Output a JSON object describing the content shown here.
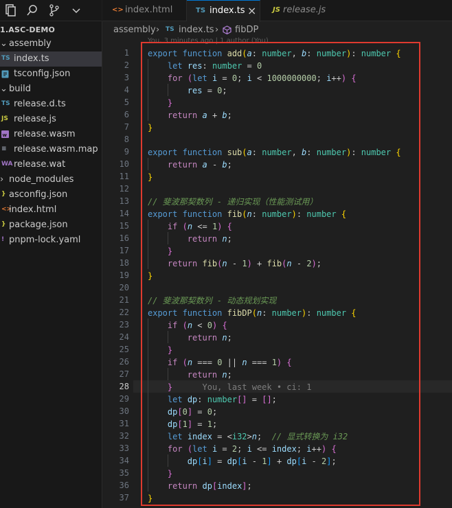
{
  "explorer": {
    "root": "1.ASC-DEMO",
    "items": [
      {
        "label": "assembly",
        "type": "folder",
        "open": true,
        "depth": 0
      },
      {
        "label": "index.ts",
        "type": "ts",
        "badge": "TS",
        "depth": 1,
        "active": true
      },
      {
        "label": "tsconfig.json",
        "type": "json",
        "badge": "",
        "depth": 1
      },
      {
        "label": "build",
        "type": "folder",
        "open": true,
        "depth": 0
      },
      {
        "label": "release.d.ts",
        "type": "ts",
        "badge": "TS",
        "depth": 1
      },
      {
        "label": "release.js",
        "type": "js",
        "badge": "JS",
        "depth": 1
      },
      {
        "label": "release.wasm",
        "type": "wasm",
        "badge": "",
        "depth": 1
      },
      {
        "label": "release.wasm.map",
        "type": "map",
        "badge": "≡",
        "depth": 1
      },
      {
        "label": "release.wat",
        "type": "wat",
        "badge": "WA",
        "depth": 1
      },
      {
        "label": "node_modules",
        "type": "folder",
        "open": false,
        "depth": 0
      },
      {
        "label": "asconfig.json",
        "type": "json",
        "badge": "}",
        "depth": 0
      },
      {
        "label": "index.html",
        "type": "html",
        "badge": "<>",
        "depth": 0
      },
      {
        "label": "package.json",
        "type": "json",
        "badge": "}",
        "depth": 0
      },
      {
        "label": "pnpm-lock.yaml",
        "type": "yaml",
        "badge": "!",
        "depth": 0
      }
    ]
  },
  "tabs": [
    {
      "label": "index.html",
      "icon": "<>",
      "active": false
    },
    {
      "label": "index.ts",
      "icon": "TS",
      "active": true,
      "close": "×"
    },
    {
      "label": "release.js",
      "icon": "JS",
      "active": false
    }
  ],
  "breadcrumb": {
    "folder": "assembly",
    "file_badge": "TS",
    "file": "index.ts",
    "symbol": "fibDP"
  },
  "codelens": "You, 3 minutes ago | 1 author (You)",
  "editor": {
    "current_line": 28,
    "line_numbers": [
      "1",
      "2",
      "3",
      "4",
      "5",
      "6",
      "7",
      "8",
      "9",
      "10",
      "11",
      "12",
      "13",
      "14",
      "15",
      "16",
      "17",
      "18",
      "19",
      "20",
      "21",
      "22",
      "23",
      "24",
      "25",
      "26",
      "27",
      "28",
      "29",
      "30",
      "31",
      "32",
      "33",
      "34",
      "35",
      "36",
      "37"
    ],
    "lines": [
      [
        [
          "kw",
          "export "
        ],
        [
          "kw",
          "function "
        ],
        [
          "fn",
          "add"
        ],
        [
          "b1",
          "("
        ],
        [
          "pm",
          "a"
        ],
        [
          "p",
          ": "
        ],
        [
          "ty",
          "number"
        ],
        [
          "p",
          ", "
        ],
        [
          "pm",
          "b"
        ],
        [
          "p",
          ": "
        ],
        [
          "ty",
          "number"
        ],
        [
          "b1",
          ")"
        ],
        [
          "p",
          ": "
        ],
        [
          "ty",
          "number"
        ],
        [
          "p",
          " "
        ],
        [
          "b1",
          "{"
        ]
      ],
      [
        [
          "p",
          "    "
        ],
        [
          "kw",
          "let "
        ],
        [
          "vr",
          "res"
        ],
        [
          "p",
          ": "
        ],
        [
          "ty",
          "number"
        ],
        [
          "p",
          " = "
        ],
        [
          "nm",
          "0"
        ]
      ],
      [
        [
          "p",
          "    "
        ],
        [
          "kc",
          "for "
        ],
        [
          "b2",
          "("
        ],
        [
          "kw",
          "let "
        ],
        [
          "vr",
          "i"
        ],
        [
          "p",
          " = "
        ],
        [
          "nm",
          "0"
        ],
        [
          "p",
          "; "
        ],
        [
          "vr",
          "i"
        ],
        [
          "p",
          " < "
        ],
        [
          "nm",
          "1000000000"
        ],
        [
          "p",
          "; "
        ],
        [
          "vr",
          "i"
        ],
        [
          "p",
          "++"
        ],
        [
          "b2",
          ")"
        ],
        [
          "p",
          " "
        ],
        [
          "b2",
          "{"
        ]
      ],
      [
        [
          "p",
          "        "
        ],
        [
          "vr",
          "res"
        ],
        [
          "p",
          " = "
        ],
        [
          "nm",
          "0"
        ],
        [
          "p",
          ";"
        ]
      ],
      [
        [
          "p",
          "    "
        ],
        [
          "b2",
          "}"
        ]
      ],
      [
        [
          "p",
          "    "
        ],
        [
          "kc",
          "return "
        ],
        [
          "pm",
          "a"
        ],
        [
          "p",
          " + "
        ],
        [
          "pm",
          "b"
        ],
        [
          "p",
          ";"
        ]
      ],
      [
        [
          "b1",
          "}"
        ]
      ],
      [],
      [
        [
          "kw",
          "export "
        ],
        [
          "kw",
          "function "
        ],
        [
          "fn",
          "sub"
        ],
        [
          "b1",
          "("
        ],
        [
          "pm",
          "a"
        ],
        [
          "p",
          ": "
        ],
        [
          "ty",
          "number"
        ],
        [
          "p",
          ", "
        ],
        [
          "pm",
          "b"
        ],
        [
          "p",
          ": "
        ],
        [
          "ty",
          "number"
        ],
        [
          "b1",
          ")"
        ],
        [
          "p",
          ": "
        ],
        [
          "ty",
          "number"
        ],
        [
          "p",
          " "
        ],
        [
          "b1",
          "{"
        ]
      ],
      [
        [
          "p",
          "    "
        ],
        [
          "kc",
          "return "
        ],
        [
          "pm",
          "a"
        ],
        [
          "p",
          " - "
        ],
        [
          "pm",
          "b"
        ],
        [
          "p",
          ";"
        ]
      ],
      [
        [
          "b1",
          "}"
        ]
      ],
      [],
      [
        [
          "cm",
          "// 斐波那契数列 - 递归实现（性能测试用）"
        ]
      ],
      [
        [
          "kw",
          "export "
        ],
        [
          "kw",
          "function "
        ],
        [
          "fn",
          "fib"
        ],
        [
          "b1",
          "("
        ],
        [
          "pm",
          "n"
        ],
        [
          "p",
          ": "
        ],
        [
          "ty",
          "number"
        ],
        [
          "b1",
          ")"
        ],
        [
          "p",
          ": "
        ],
        [
          "ty",
          "number"
        ],
        [
          "p",
          " "
        ],
        [
          "b1",
          "{"
        ]
      ],
      [
        [
          "p",
          "    "
        ],
        [
          "kc",
          "if "
        ],
        [
          "b2",
          "("
        ],
        [
          "pm",
          "n"
        ],
        [
          "p",
          " <= "
        ],
        [
          "nm",
          "1"
        ],
        [
          "b2",
          ")"
        ],
        [
          "p",
          " "
        ],
        [
          "b2",
          "{"
        ]
      ],
      [
        [
          "p",
          "        "
        ],
        [
          "kc",
          "return "
        ],
        [
          "pm",
          "n"
        ],
        [
          "p",
          ";"
        ]
      ],
      [
        [
          "p",
          "    "
        ],
        [
          "b2",
          "}"
        ]
      ],
      [
        [
          "p",
          "    "
        ],
        [
          "kc",
          "return "
        ],
        [
          "fn",
          "fib"
        ],
        [
          "b2",
          "("
        ],
        [
          "pm",
          "n"
        ],
        [
          "p",
          " - "
        ],
        [
          "nm",
          "1"
        ],
        [
          "b2",
          ")"
        ],
        [
          "p",
          " + "
        ],
        [
          "fn",
          "fib"
        ],
        [
          "b2",
          "("
        ],
        [
          "pm",
          "n"
        ],
        [
          "p",
          " - "
        ],
        [
          "nm",
          "2"
        ],
        [
          "b2",
          ")"
        ],
        [
          "p",
          ";"
        ]
      ],
      [
        [
          "b1",
          "}"
        ]
      ],
      [],
      [
        [
          "cm",
          "// 斐波那契数列 - 动态规划实现"
        ]
      ],
      [
        [
          "kw",
          "export "
        ],
        [
          "kw",
          "function "
        ],
        [
          "fn",
          "fibDP"
        ],
        [
          "b1",
          "("
        ],
        [
          "pm",
          "n"
        ],
        [
          "p",
          ": "
        ],
        [
          "ty",
          "number"
        ],
        [
          "b1",
          ")"
        ],
        [
          "p",
          ": "
        ],
        [
          "ty",
          "number"
        ],
        [
          "p",
          " "
        ],
        [
          "b1",
          "{"
        ]
      ],
      [
        [
          "p",
          "    "
        ],
        [
          "kc",
          "if "
        ],
        [
          "b2",
          "("
        ],
        [
          "pm",
          "n"
        ],
        [
          "p",
          " < "
        ],
        [
          "nm",
          "0"
        ],
        [
          "b2",
          ")"
        ],
        [
          "p",
          " "
        ],
        [
          "b2",
          "{"
        ]
      ],
      [
        [
          "p",
          "        "
        ],
        [
          "kc",
          "return "
        ],
        [
          "pm",
          "n"
        ],
        [
          "p",
          ";"
        ]
      ],
      [
        [
          "p",
          "    "
        ],
        [
          "b2",
          "}"
        ]
      ],
      [
        [
          "p",
          "    "
        ],
        [
          "kc",
          "if "
        ],
        [
          "b2",
          "("
        ],
        [
          "pm",
          "n"
        ],
        [
          "p",
          " === "
        ],
        [
          "nm",
          "0"
        ],
        [
          "p",
          " || "
        ],
        [
          "pm",
          "n"
        ],
        [
          "p",
          " === "
        ],
        [
          "nm",
          "1"
        ],
        [
          "b2",
          ")"
        ],
        [
          "p",
          " "
        ],
        [
          "b2",
          "{"
        ]
      ],
      [
        [
          "p",
          "        "
        ],
        [
          "kc",
          "return "
        ],
        [
          "pm",
          "n"
        ],
        [
          "p",
          ";"
        ]
      ],
      [
        [
          "p",
          "    "
        ],
        [
          "b2",
          "}"
        ],
        [
          "blame",
          "      You, last week • ci: 1"
        ]
      ],
      [
        [
          "p",
          "    "
        ],
        [
          "kw",
          "let "
        ],
        [
          "vr",
          "dp"
        ],
        [
          "p",
          ": "
        ],
        [
          "ty",
          "number"
        ],
        [
          "b2",
          "[]"
        ],
        [
          "p",
          " = "
        ],
        [
          "b2",
          "[]"
        ],
        [
          "p",
          ";"
        ]
      ],
      [
        [
          "p",
          "    "
        ],
        [
          "vr",
          "dp"
        ],
        [
          "b2",
          "["
        ],
        [
          "nm",
          "0"
        ],
        [
          "b2",
          "]"
        ],
        [
          "p",
          " = "
        ],
        [
          "nm",
          "0"
        ],
        [
          "p",
          ";"
        ]
      ],
      [
        [
          "p",
          "    "
        ],
        [
          "vr",
          "dp"
        ],
        [
          "b2",
          "["
        ],
        [
          "nm",
          "1"
        ],
        [
          "b2",
          "]"
        ],
        [
          "p",
          " = "
        ],
        [
          "nm",
          "1"
        ],
        [
          "p",
          ";"
        ]
      ],
      [
        [
          "p",
          "    "
        ],
        [
          "kw",
          "let "
        ],
        [
          "vr",
          "index"
        ],
        [
          "p",
          " = <"
        ],
        [
          "ty",
          "i32"
        ],
        [
          "p",
          ">"
        ],
        [
          "pm",
          "n"
        ],
        [
          "p",
          ";  "
        ],
        [
          "cm",
          "// 显式转换为 i32"
        ]
      ],
      [
        [
          "p",
          "    "
        ],
        [
          "kc",
          "for "
        ],
        [
          "b2",
          "("
        ],
        [
          "kw",
          "let "
        ],
        [
          "vr",
          "i"
        ],
        [
          "p",
          " = "
        ],
        [
          "nm",
          "2"
        ],
        [
          "p",
          "; "
        ],
        [
          "vr",
          "i"
        ],
        [
          "p",
          " <= "
        ],
        [
          "vr",
          "index"
        ],
        [
          "p",
          "; "
        ],
        [
          "vr",
          "i"
        ],
        [
          "p",
          "++"
        ],
        [
          "b2",
          ")"
        ],
        [
          "p",
          " "
        ],
        [
          "b2",
          "{"
        ]
      ],
      [
        [
          "p",
          "        "
        ],
        [
          "vr",
          "dp"
        ],
        [
          "b3",
          "["
        ],
        [
          "vr",
          "i"
        ],
        [
          "b3",
          "]"
        ],
        [
          "p",
          " = "
        ],
        [
          "vr",
          "dp"
        ],
        [
          "b3",
          "["
        ],
        [
          "vr",
          "i"
        ],
        [
          "p",
          " - "
        ],
        [
          "nm",
          "1"
        ],
        [
          "b3",
          "]"
        ],
        [
          "p",
          " + "
        ],
        [
          "vr",
          "dp"
        ],
        [
          "b3",
          "["
        ],
        [
          "vr",
          "i"
        ],
        [
          "p",
          " - "
        ],
        [
          "nm",
          "2"
        ],
        [
          "b3",
          "]"
        ],
        [
          "p",
          ";"
        ]
      ],
      [
        [
          "p",
          "    "
        ],
        [
          "b2",
          "}"
        ]
      ],
      [
        [
          "p",
          "    "
        ],
        [
          "kc",
          "return "
        ],
        [
          "vr",
          "dp"
        ],
        [
          "b2",
          "["
        ],
        [
          "vr",
          "index"
        ],
        [
          "b2",
          "]"
        ],
        [
          "p",
          ";"
        ]
      ],
      [
        [
          "b1",
          "}"
        ]
      ]
    ]
  },
  "colors": {
    "accent": "#0078d4",
    "highlight_border": "#e03a2f",
    "ts_badge": "#519aba",
    "js_badge": "#cbcb41",
    "wasm_badge": "#a074c4"
  }
}
